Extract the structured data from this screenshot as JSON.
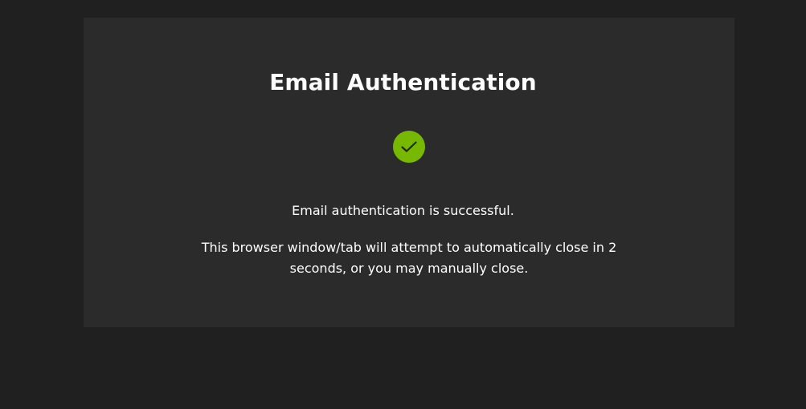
{
  "page": {
    "title": "Email Authentication",
    "status_icon": "check-circle-icon",
    "success_message": "Email authentication is successful.",
    "close_message": "This browser window/tab will attempt to automatically close in 2 seconds, or you may manually close."
  },
  "colors": {
    "background": "#202020",
    "card": "#2b2b2b",
    "accent": "#76b900",
    "text": "#ffffff"
  }
}
